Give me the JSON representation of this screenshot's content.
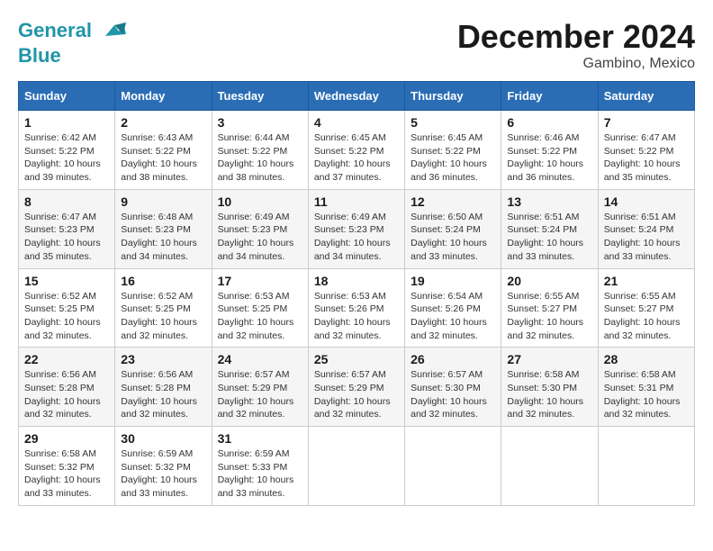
{
  "logo": {
    "line1": "General",
    "line2": "Blue"
  },
  "title": "December 2024",
  "location": "Gambino, Mexico",
  "days_of_week": [
    "Sunday",
    "Monday",
    "Tuesday",
    "Wednesday",
    "Thursday",
    "Friday",
    "Saturday"
  ],
  "weeks": [
    [
      {
        "day": "1",
        "info": "Sunrise: 6:42 AM\nSunset: 5:22 PM\nDaylight: 10 hours and 39 minutes."
      },
      {
        "day": "2",
        "info": "Sunrise: 6:43 AM\nSunset: 5:22 PM\nDaylight: 10 hours and 38 minutes."
      },
      {
        "day": "3",
        "info": "Sunrise: 6:44 AM\nSunset: 5:22 PM\nDaylight: 10 hours and 38 minutes."
      },
      {
        "day": "4",
        "info": "Sunrise: 6:45 AM\nSunset: 5:22 PM\nDaylight: 10 hours and 37 minutes."
      },
      {
        "day": "5",
        "info": "Sunrise: 6:45 AM\nSunset: 5:22 PM\nDaylight: 10 hours and 36 minutes."
      },
      {
        "day": "6",
        "info": "Sunrise: 6:46 AM\nSunset: 5:22 PM\nDaylight: 10 hours and 36 minutes."
      },
      {
        "day": "7",
        "info": "Sunrise: 6:47 AM\nSunset: 5:22 PM\nDaylight: 10 hours and 35 minutes."
      }
    ],
    [
      {
        "day": "8",
        "info": "Sunrise: 6:47 AM\nSunset: 5:23 PM\nDaylight: 10 hours and 35 minutes."
      },
      {
        "day": "9",
        "info": "Sunrise: 6:48 AM\nSunset: 5:23 PM\nDaylight: 10 hours and 34 minutes."
      },
      {
        "day": "10",
        "info": "Sunrise: 6:49 AM\nSunset: 5:23 PM\nDaylight: 10 hours and 34 minutes."
      },
      {
        "day": "11",
        "info": "Sunrise: 6:49 AM\nSunset: 5:23 PM\nDaylight: 10 hours and 34 minutes."
      },
      {
        "day": "12",
        "info": "Sunrise: 6:50 AM\nSunset: 5:24 PM\nDaylight: 10 hours and 33 minutes."
      },
      {
        "day": "13",
        "info": "Sunrise: 6:51 AM\nSunset: 5:24 PM\nDaylight: 10 hours and 33 minutes."
      },
      {
        "day": "14",
        "info": "Sunrise: 6:51 AM\nSunset: 5:24 PM\nDaylight: 10 hours and 33 minutes."
      }
    ],
    [
      {
        "day": "15",
        "info": "Sunrise: 6:52 AM\nSunset: 5:25 PM\nDaylight: 10 hours and 32 minutes."
      },
      {
        "day": "16",
        "info": "Sunrise: 6:52 AM\nSunset: 5:25 PM\nDaylight: 10 hours and 32 minutes."
      },
      {
        "day": "17",
        "info": "Sunrise: 6:53 AM\nSunset: 5:25 PM\nDaylight: 10 hours and 32 minutes."
      },
      {
        "day": "18",
        "info": "Sunrise: 6:53 AM\nSunset: 5:26 PM\nDaylight: 10 hours and 32 minutes."
      },
      {
        "day": "19",
        "info": "Sunrise: 6:54 AM\nSunset: 5:26 PM\nDaylight: 10 hours and 32 minutes."
      },
      {
        "day": "20",
        "info": "Sunrise: 6:55 AM\nSunset: 5:27 PM\nDaylight: 10 hours and 32 minutes."
      },
      {
        "day": "21",
        "info": "Sunrise: 6:55 AM\nSunset: 5:27 PM\nDaylight: 10 hours and 32 minutes."
      }
    ],
    [
      {
        "day": "22",
        "info": "Sunrise: 6:56 AM\nSunset: 5:28 PM\nDaylight: 10 hours and 32 minutes."
      },
      {
        "day": "23",
        "info": "Sunrise: 6:56 AM\nSunset: 5:28 PM\nDaylight: 10 hours and 32 minutes."
      },
      {
        "day": "24",
        "info": "Sunrise: 6:57 AM\nSunset: 5:29 PM\nDaylight: 10 hours and 32 minutes."
      },
      {
        "day": "25",
        "info": "Sunrise: 6:57 AM\nSunset: 5:29 PM\nDaylight: 10 hours and 32 minutes."
      },
      {
        "day": "26",
        "info": "Sunrise: 6:57 AM\nSunset: 5:30 PM\nDaylight: 10 hours and 32 minutes."
      },
      {
        "day": "27",
        "info": "Sunrise: 6:58 AM\nSunset: 5:30 PM\nDaylight: 10 hours and 32 minutes."
      },
      {
        "day": "28",
        "info": "Sunrise: 6:58 AM\nSunset: 5:31 PM\nDaylight: 10 hours and 32 minutes."
      }
    ],
    [
      {
        "day": "29",
        "info": "Sunrise: 6:58 AM\nSunset: 5:32 PM\nDaylight: 10 hours and 33 minutes."
      },
      {
        "day": "30",
        "info": "Sunrise: 6:59 AM\nSunset: 5:32 PM\nDaylight: 10 hours and 33 minutes."
      },
      {
        "day": "31",
        "info": "Sunrise: 6:59 AM\nSunset: 5:33 PM\nDaylight: 10 hours and 33 minutes."
      },
      null,
      null,
      null,
      null
    ]
  ]
}
